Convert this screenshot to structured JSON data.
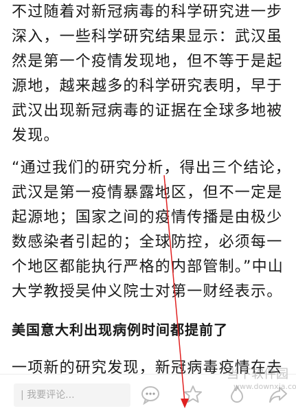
{
  "article": {
    "paragraph1": [
      "不过随着对新冠病毒的科学研究进一步",
      "深入，一些科学研究结果显示：武汉虽",
      "然是第一个疫情发现地，但不等于是起",
      "源地，越来越多的科学研究表明，早于",
      "武汉出现新冠病毒的证据在全球多地被",
      "发现。"
    ],
    "paragraph2": [
      "“通过我们的研究分析，得出三个结论，",
      "武汉是第一疫情暴露地区，但不一定是",
      "起源地；国家之间的疫情传播是由极少",
      "数感染者引起的；全球防控，必须每一",
      "个地区都能执行严格的内部管制。”中山",
      "大学教授吴仲义院士对第一财经表示。"
    ],
    "heading": "美国意大利出现病例时间都提前了",
    "paragraph3": [
      "一项新的研究发现，新冠病毒疫情在去"
    ]
  },
  "bottom_bar": {
    "comment_placeholder": "| 我要评论...",
    "icons": [
      "comment-icon",
      "star-icon",
      "fire-icon",
      "share-icon"
    ]
  },
  "watermark": {
    "text": "当下软件园",
    "sub": "www.downxia.com"
  },
  "colors": {
    "text": "#1a1a1a",
    "icon": "#cfcfcf",
    "annotation_arrow": "#e02020"
  }
}
